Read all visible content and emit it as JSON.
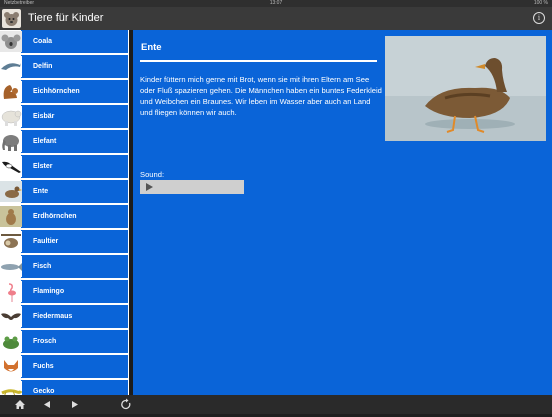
{
  "statusbar": {
    "carrier": "Netzbetreiber",
    "time": "13:07",
    "battery": "100 %"
  },
  "app": {
    "title": "Tiere für Kinder"
  },
  "sidebar": {
    "items": [
      {
        "label": "Coala",
        "thumb": "koala"
      },
      {
        "label": "Delfin",
        "thumb": "dolphin"
      },
      {
        "label": "Eichhörnchen",
        "thumb": "squirrel"
      },
      {
        "label": "Eisbär",
        "thumb": "polar-bear"
      },
      {
        "label": "Elefant",
        "thumb": "elephant"
      },
      {
        "label": "Elster",
        "thumb": "magpie"
      },
      {
        "label": "Ente",
        "thumb": "duck"
      },
      {
        "label": "Erdhörnchen",
        "thumb": "ground-squirrel"
      },
      {
        "label": "Faultier",
        "thumb": "sloth"
      },
      {
        "label": "Fisch",
        "thumb": "fish"
      },
      {
        "label": "Flamingo",
        "thumb": "flamingo"
      },
      {
        "label": "Fiedermaus",
        "thumb": "bat"
      },
      {
        "label": "Frosch",
        "thumb": "frog"
      },
      {
        "label": "Fuchs",
        "thumb": "fox"
      },
      {
        "label": "Gecko",
        "thumb": "gecko"
      }
    ]
  },
  "detail": {
    "title": "Ente",
    "description": "Kinder füttern mich gerne mit Brot, wenn sie mit ihren Eltern am See oder Fluß spazieren gehen. Die Männchen haben ein buntes Federkleid und Weibchen ein Braunes. Wir leben im Wasser aber auch an Land und fliegen können wir auch.",
    "sound_label": "Sound:"
  },
  "colors": {
    "accent": "#0a64d8",
    "bar": "#3a3a3a"
  },
  "toolbar": {
    "icons": [
      "home-icon",
      "back-arrow-icon",
      "forward-arrow-icon",
      "refresh-icon"
    ]
  }
}
